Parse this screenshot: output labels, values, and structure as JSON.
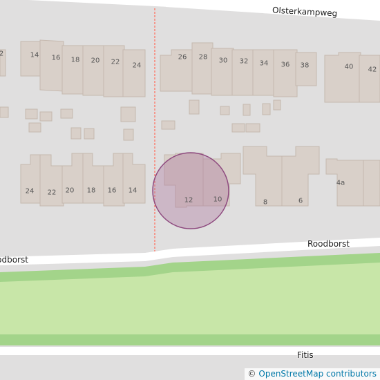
{
  "streets": {
    "top": "Olsterkampweg",
    "middle_right": "Roodborst",
    "middle_left": "Roodborst",
    "bottom": "Fitis"
  },
  "house_numbers": {
    "row1_left": [
      "14",
      "16",
      "18",
      "20",
      "22",
      "24"
    ],
    "row1_left_edge": "2",
    "row1_right": [
      "26",
      "28",
      "30",
      "32",
      "34",
      "36",
      "38",
      "40",
      "42"
    ],
    "row2_left": [
      "24",
      "22",
      "20",
      "18",
      "16",
      "14"
    ],
    "row2_right": [
      "12",
      "10",
      "8",
      "6",
      "4a"
    ]
  },
  "marker": {
    "type": "location-circle",
    "color": "#b07aa1"
  },
  "attribution": {
    "symbol": "©",
    "text": "OpenStreetMap contributors"
  },
  "colors": {
    "background": "#e0dfdf",
    "building": "#d9d0c9",
    "building_outline": "#c5b8ae",
    "road": "#ffffff",
    "park": "#c8e6a8",
    "park_border": "#a3d48a",
    "path": "#fa8072"
  }
}
